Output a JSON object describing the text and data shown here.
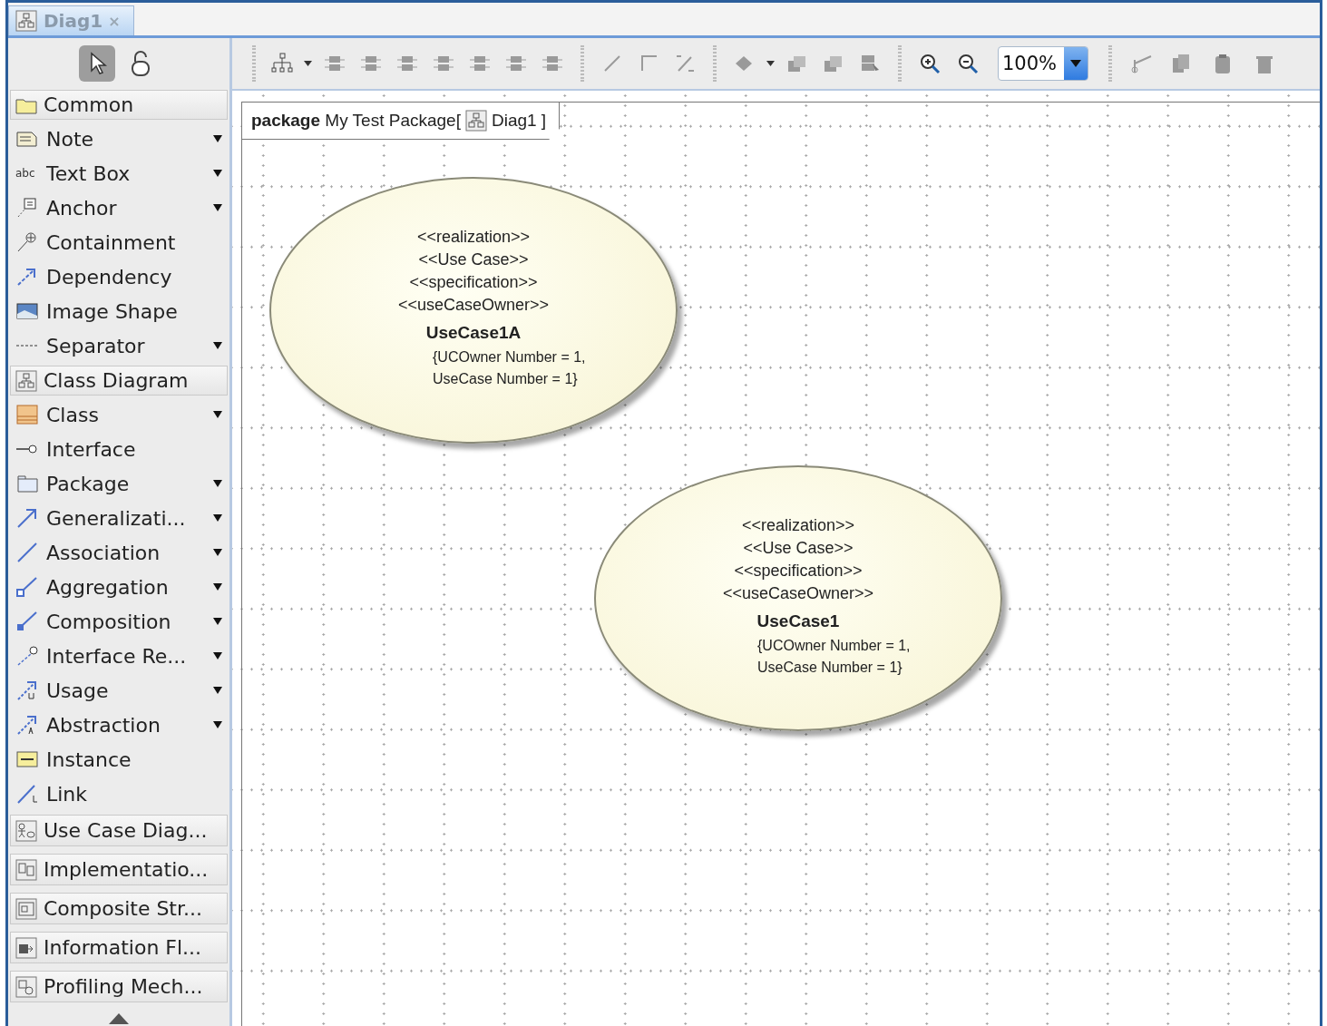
{
  "tabs": [
    {
      "label": "Diag1",
      "close": "×",
      "selected": true
    }
  ],
  "palette": {
    "tools": [
      {
        "kind": "pointer",
        "selected": true
      },
      {
        "kind": "lock",
        "selected": false
      }
    ],
    "items": [
      {
        "kind": "header",
        "label": "Common"
      },
      {
        "kind": "tool",
        "label": "Note",
        "dropdown": true
      },
      {
        "kind": "tool",
        "label": "Text Box",
        "dropdown": true,
        "icon_text": "abc"
      },
      {
        "kind": "tool",
        "label": "Anchor",
        "dropdown": true
      },
      {
        "kind": "tool",
        "label": "Containment",
        "dropdown": false
      },
      {
        "kind": "tool",
        "label": "Dependency",
        "dropdown": false
      },
      {
        "kind": "tool",
        "label": "Image Shape",
        "dropdown": false
      },
      {
        "kind": "tool",
        "label": "Separator",
        "dropdown": true
      },
      {
        "kind": "header",
        "label": "Class Diagram"
      },
      {
        "kind": "tool",
        "label": "Class",
        "dropdown": true
      },
      {
        "kind": "tool",
        "label": "Interface",
        "dropdown": false
      },
      {
        "kind": "tool",
        "label": "Package",
        "dropdown": true
      },
      {
        "kind": "tool",
        "label": "Generalizati...",
        "dropdown": true
      },
      {
        "kind": "tool",
        "label": "Association",
        "dropdown": true
      },
      {
        "kind": "tool",
        "label": "Aggregation",
        "dropdown": true
      },
      {
        "kind": "tool",
        "label": "Composition",
        "dropdown": true
      },
      {
        "kind": "tool",
        "label": "Interface Re...",
        "dropdown": true
      },
      {
        "kind": "tool",
        "label": "Usage",
        "dropdown": true
      },
      {
        "kind": "tool",
        "label": "Abstraction",
        "dropdown": true
      },
      {
        "kind": "tool",
        "label": "Instance",
        "dropdown": false
      },
      {
        "kind": "tool",
        "label": "Link",
        "dropdown": false
      },
      {
        "kind": "collapsed",
        "label": "Use Case Diag..."
      },
      {
        "kind": "collapsed",
        "label": "Implementatio..."
      },
      {
        "kind": "collapsed",
        "label": "Composite Str..."
      },
      {
        "kind": "collapsed",
        "label": "Information Fl..."
      },
      {
        "kind": "collapsed",
        "label": "Profiling Mech..."
      }
    ]
  },
  "toolbar": {
    "groups": [
      {
        "buttons": [
          {
            "kind": "layout"
          },
          {
            "kind": "caret"
          },
          {
            "kind": "align"
          },
          {
            "kind": "align"
          },
          {
            "kind": "align"
          },
          {
            "kind": "align"
          },
          {
            "kind": "align"
          },
          {
            "kind": "align"
          },
          {
            "kind": "align"
          }
        ]
      },
      {
        "buttons": [
          {
            "kind": "line"
          },
          {
            "kind": "elbow"
          },
          {
            "kind": "route"
          }
        ]
      },
      {
        "buttons": [
          {
            "kind": "fill"
          },
          {
            "kind": "caret"
          },
          {
            "kind": "stack"
          },
          {
            "kind": "stack"
          },
          {
            "kind": "select"
          }
        ]
      },
      {
        "buttons": [
          {
            "kind": "zoom-in"
          },
          {
            "kind": "zoom-out"
          }
        ]
      }
    ],
    "zoom": {
      "value": "100%"
    },
    "edit_buttons": [
      {
        "kind": "cut"
      },
      {
        "kind": "copy"
      },
      {
        "kind": "paste"
      },
      {
        "kind": "delete"
      }
    ]
  },
  "diagram": {
    "frame": {
      "title": "**package** My Test Package[",
      "diagram": "Diag1 ]"
    },
    "use_cases": [
      {
        "stereotypes": [
          "<<realization>>",
          "<<Use Case>>",
          "<<specification>>",
          "<<useCaseOwner>>"
        ],
        "name": "UseCase1A",
        "properties": [
          "{UCOwner Number = 1,",
          "UseCase Number = 1}"
        ]
      },
      {
        "stereotypes": [
          "<<realization>>",
          "<<Use Case>>",
          "<<specification>>",
          "<<useCaseOwner>>"
        ],
        "name": "UseCase1",
        "properties": [
          "{UCOwner Number = 1,",
          "UseCase Number = 1}"
        ]
      }
    ]
  }
}
